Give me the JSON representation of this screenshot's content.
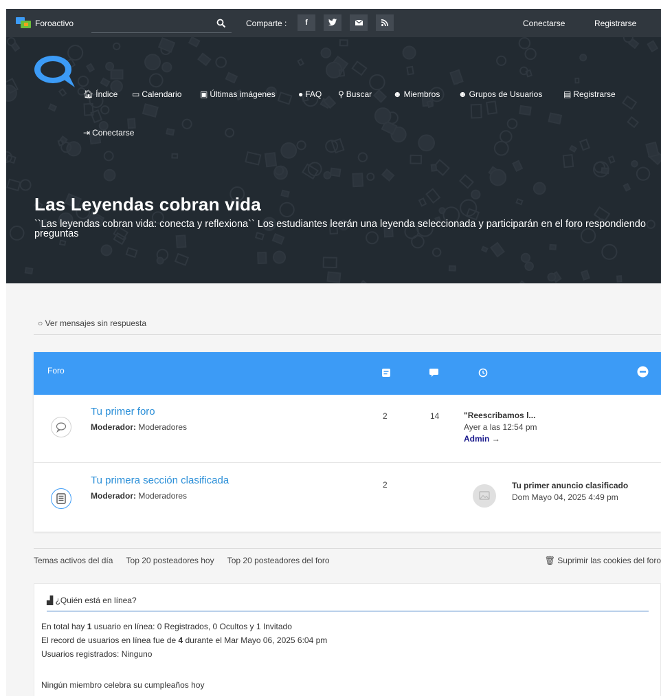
{
  "topbar": {
    "brand": "Foroactivo",
    "share_label": "Comparte :",
    "share_buttons": [
      "f",
      "t",
      "e",
      "r"
    ],
    "login": "Conectarse",
    "register": "Registrarse"
  },
  "nav": {
    "items": [
      "Índice",
      "Calendario",
      "Últimas imágenes",
      "FAQ",
      "Buscar",
      "Miembros",
      "Grupos de Usuarios",
      "Registrarse",
      "Conectarse"
    ]
  },
  "hero": {
    "title": "Las Leyendas cobran vida",
    "description": "``Las leyendas cobran vida: conecta y reflexiona`` Los estudiantes leerán una leyenda seleccionada y participarán en el foro respondiendo preguntas"
  },
  "unanswered_link": "Ver mensajes sin respuesta",
  "forum_table": {
    "header": "Foro",
    "rows": [
      {
        "title": "Tu primer foro",
        "moderator_label": "Moderador:",
        "moderator": "Moderadores",
        "topics": "2",
        "posts": "14",
        "last_title": "\"Reescribamos l...",
        "last_date": "Ayer a las 12:54 pm",
        "last_author": "Admin"
      },
      {
        "title": "Tu primera sección clasificada",
        "moderator_label": "Moderador:",
        "moderator": "Moderadores",
        "topics": "2",
        "posts": "",
        "last_title": "Tu primer anuncio clasificado",
        "last_date": "Dom Mayo 04, 2025 4:49 pm",
        "last_author": ""
      }
    ]
  },
  "footer_links": [
    "Temas activos del día",
    "Top 20 posteadores hoy",
    "Top 20 posteadores del foro"
  ],
  "cookies_link": "Suprimir las cookies del foro",
  "online": {
    "title": "¿Quién está en línea?",
    "total_prefix": "En total hay ",
    "total_count": "1",
    "total_suffix": " usuario en línea: 0 Registrados, 0 Ocultos y 1 Invitado",
    "record_prefix": "El record de usuarios en línea fue de ",
    "record_count": "4",
    "record_suffix": " durante el Mar Mayo 06, 2025 6:04 pm",
    "registered": "Usuarios registrados: Ninguno",
    "birthday": "Ningún miembro celebra su cumpleaños hoy"
  },
  "colors": {
    "header_bg": "#30373e",
    "hero_bg": "#222a31",
    "forum_header": "#3c9bf6",
    "link": "#2b8fd8"
  }
}
